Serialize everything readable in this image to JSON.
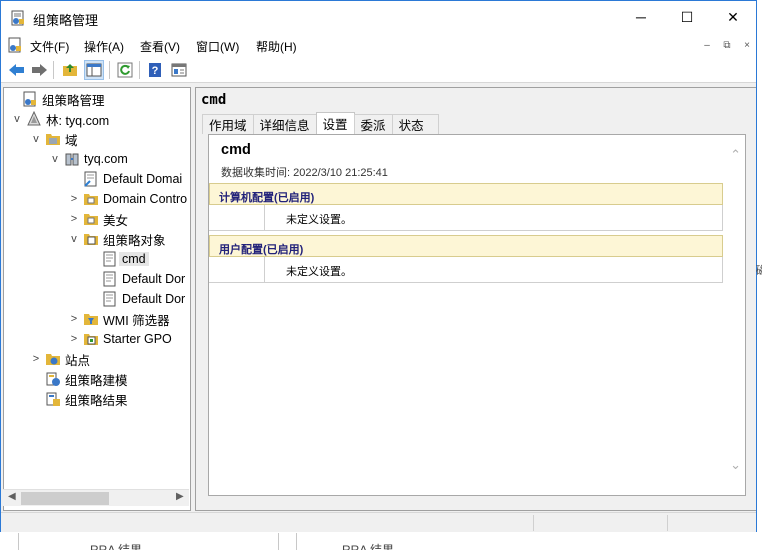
{
  "window": {
    "title": "组策略管理"
  },
  "titlebar": {
    "minimize": "─",
    "maximize": "☐",
    "close": "✕"
  },
  "menu": {
    "items": [
      "文件(F)",
      "操作(A)",
      "查看(V)",
      "窗口(W)",
      "帮助(H)"
    ],
    "mdi_controls": [
      "–",
      "⧉",
      "×"
    ]
  },
  "toolbar": {
    "buttons": [
      "back-icon",
      "forward-icon",
      "up-folder-icon",
      "show-hide-tree-icon",
      "refresh-icon",
      "help-icon",
      "properties-icon"
    ]
  },
  "tree": {
    "items": [
      {
        "label": "组策略管理",
        "expander": "",
        "icon": "gpm-root-icon"
      },
      {
        "label": "林: tyq.com",
        "expander": "v",
        "icon": "forest-icon"
      },
      {
        "label": "域",
        "expander": "v",
        "icon": "domains-folder-icon"
      },
      {
        "label": "tyq.com",
        "expander": "v",
        "icon": "domain-icon"
      },
      {
        "label": "Default Domai",
        "expander": "",
        "icon": "gpo-link-icon"
      },
      {
        "label": "Domain Contro",
        "expander": ">",
        "icon": "ou-icon"
      },
      {
        "label": "美女",
        "expander": ">",
        "icon": "ou-icon"
      },
      {
        "label": "组策略对象",
        "expander": "v",
        "icon": "gpo-folder-icon"
      },
      {
        "label": "cmd",
        "expander": "",
        "icon": "gpo-icon",
        "selected": true
      },
      {
        "label": "Default Dor",
        "expander": "",
        "icon": "gpo-icon"
      },
      {
        "label": "Default Dor",
        "expander": "",
        "icon": "gpo-icon"
      },
      {
        "label": "WMI 筛选器",
        "expander": ">",
        "icon": "wmi-folder-icon"
      },
      {
        "label": "Starter GPO",
        "expander": ">",
        "icon": "starter-gpo-folder-icon"
      },
      {
        "label": "站点",
        "expander": ">",
        "icon": "sites-icon"
      },
      {
        "label": "组策略建模",
        "expander": "",
        "icon": "modeling-icon"
      },
      {
        "label": "组策略结果",
        "expander": "",
        "icon": "results-icon"
      }
    ]
  },
  "details": {
    "title": "cmd",
    "tabs": [
      "作用域",
      "详细信息",
      "设置",
      "委派",
      "状态"
    ],
    "active_tab": "设置",
    "report": {
      "title": "cmd",
      "collected": "数据收集时间: 2022/3/10 21:25:41",
      "sections": [
        {
          "header": "计算机配置(已启用)",
          "body": "未定义设置。"
        },
        {
          "header": "用户配置(已启用)",
          "body": "未定义设置。"
        }
      ]
    }
  },
  "background": {
    "labels": [
      "RRA 结果",
      "RRA 结果"
    ],
    "edge_char": "磁"
  },
  "colors": {
    "accent_border": "#2b79d6",
    "section_header_bg": "#fdf6d6",
    "section_header_text": "#22227a"
  }
}
